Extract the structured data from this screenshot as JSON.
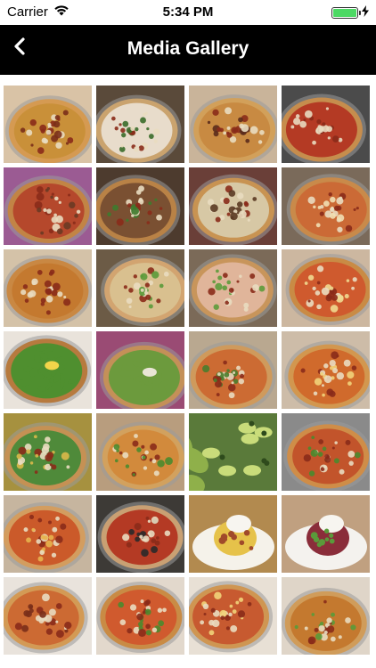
{
  "status": {
    "carrier": "Carrier",
    "time": "5:34 PM",
    "battery_level": 1.0
  },
  "header": {
    "title": "Media Gallery",
    "back_icon": "chevron-left-icon"
  },
  "colors": {
    "nav_background": "#000000",
    "battery_green": "#4cd964"
  },
  "gallery": {
    "items": [
      {
        "bg": "#d9c3a6",
        "kind": "pizza",
        "crust": "#d59a52",
        "top": "#c99039",
        "accent": "#7a2f1a"
      },
      {
        "bg": "#5a4a3a",
        "kind": "pizza",
        "crust": "#caa36e",
        "top": "#e8dccb",
        "accent": "#3a6b2a"
      },
      {
        "bg": "#c9b49a",
        "kind": "pizza",
        "crust": "#d2a05a",
        "top": "#c88a42",
        "accent": "#5b2b1c"
      },
      {
        "bg": "#4b4b4b",
        "kind": "pizza",
        "crust": "#c68d4d",
        "top": "#b43a24",
        "accent": "#e7d9bf"
      },
      {
        "bg": "#9b5b93",
        "kind": "pizza",
        "crust": "#c28445",
        "top": "#b5482c",
        "accent": "#6a3a24"
      },
      {
        "bg": "#4d3b2e",
        "kind": "pizza",
        "crust": "#b98246",
        "top": "#7a5032",
        "accent": "#3e7a2e"
      },
      {
        "bg": "#6a3f38",
        "kind": "pizza",
        "crust": "#c89352",
        "top": "#d7c8a5",
        "accent": "#5b3a24"
      },
      {
        "bg": "#7a6a5a",
        "kind": "pizza",
        "crust": "#c98a4a",
        "top": "#cb6a36",
        "accent": "#f1dfb2"
      },
      {
        "bg": "#d4c2a8",
        "kind": "pizza",
        "crust": "#c98843",
        "top": "#c4792f",
        "accent": "#8a2b1a"
      },
      {
        "bg": "#6c5b46",
        "kind": "pizza",
        "crust": "#d2a470",
        "top": "#d9c08f",
        "accent": "#5a9a3a"
      },
      {
        "bg": "#7b6a58",
        "kind": "pizza",
        "crust": "#c8955b",
        "top": "#e0b59a",
        "accent": "#5d9b3b"
      },
      {
        "bg": "#ccb7a0",
        "kind": "pizza",
        "crust": "#c98b45",
        "top": "#cf5a2e",
        "accent": "#f0d990"
      },
      {
        "bg": "#e9e3db",
        "kind": "salad",
        "crust": "#b77a3e",
        "top": "#4f8f2f",
        "accent": "#f2d54a"
      },
      {
        "bg": "#9a4b74",
        "kind": "salad",
        "crust": "#c49058",
        "top": "#6c9a3d",
        "accent": "#e9e5d6"
      },
      {
        "bg": "#b9a890",
        "kind": "pizza",
        "crust": "#cf9a5c",
        "top": "#cc6b33",
        "accent": "#4a7d2e"
      },
      {
        "bg": "#cdbca8",
        "kind": "pizza",
        "crust": "#d2974f",
        "top": "#d06a2c",
        "accent": "#f1d37a"
      },
      {
        "bg": "#a6913f",
        "kind": "pizza",
        "crust": "#c59154",
        "top": "#4f8a3a",
        "accent": "#d9b84a"
      },
      {
        "bg": "#b89d7e",
        "kind": "pizza",
        "crust": "#d2a15e",
        "top": "#d28a3c",
        "accent": "#4a8a2e"
      },
      {
        "bg": "#5a7a3a",
        "kind": "avocado",
        "crust": "#8fb04a",
        "top": "#c9dc7a",
        "accent": "#2e4a1c"
      },
      {
        "bg": "#8a8a8a",
        "kind": "pizza",
        "crust": "#cf8d48",
        "top": "#c2542b",
        "accent": "#4a8a2e"
      },
      {
        "bg": "#c6b59f",
        "kind": "pizza",
        "crust": "#d39d5f",
        "top": "#cb5a2a",
        "accent": "#e7b34e"
      },
      {
        "bg": "#3d3a36",
        "kind": "pizza",
        "crust": "#c9a073",
        "top": "#b43a24",
        "accent": "#2a2a2a"
      },
      {
        "bg": "#b28a4f",
        "kind": "plate",
        "crust": "#f5f2ea",
        "top": "#e6c24a",
        "accent": "#a04a2a"
      },
      {
        "bg": "#c0a080",
        "kind": "plate",
        "crust": "#f4f2ee",
        "top": "#8a2d3a",
        "accent": "#5a9a3a"
      },
      {
        "bg": "#e9e3dc",
        "kind": "pizza",
        "crust": "#d39a55",
        "top": "#cc6a33",
        "accent": "#7a2f1a"
      },
      {
        "bg": "#e2d8cc",
        "kind": "pizza",
        "crust": "#c98b45",
        "top": "#d05a2e",
        "accent": "#4a8a2e"
      },
      {
        "bg": "#e8e0d5",
        "kind": "pizza",
        "crust": "#cf9652",
        "top": "#c75a30",
        "accent": "#f1d37a"
      },
      {
        "bg": "#dfd5c8",
        "kind": "pizza",
        "crust": "#d09c5a",
        "top": "#c4792f",
        "accent": "#5a9a3a"
      }
    ]
  }
}
